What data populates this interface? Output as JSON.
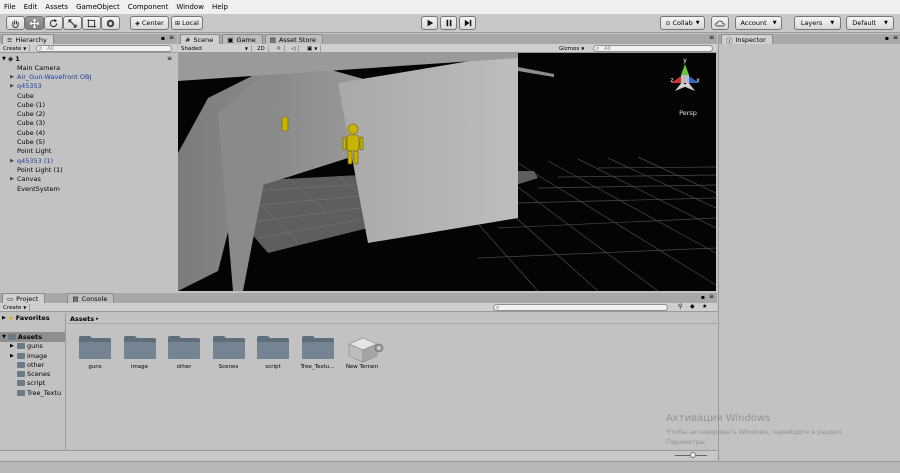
{
  "menu": [
    "File",
    "Edit",
    "Assets",
    "GameObject",
    "Component",
    "Window",
    "Help"
  ],
  "toolbar": {
    "pivot_label": "Center",
    "space_label": "Local",
    "collab_label": "Collab",
    "account_label": "Account",
    "layers_label": "Layers",
    "layout_label": "Default"
  },
  "hierarchy": {
    "tab_label": "Hierarchy",
    "create_label": "Create",
    "search_placeholder": "All",
    "scene_name": "1",
    "items": [
      {
        "label": "Main Camera",
        "arrow": "",
        "color": "black"
      },
      {
        "label": "Air_Gun-Wavefront OBJ",
        "arrow": "▶",
        "color": "blue"
      },
      {
        "label": "q45353",
        "arrow": "▶",
        "color": "blue"
      },
      {
        "label": "Cube",
        "arrow": "",
        "color": "black"
      },
      {
        "label": "Cube (1)",
        "arrow": "",
        "color": "black"
      },
      {
        "label": "Cube (2)",
        "arrow": "",
        "color": "black"
      },
      {
        "label": "Cube (3)",
        "arrow": "",
        "color": "black"
      },
      {
        "label": "Cube (4)",
        "arrow": "",
        "color": "black"
      },
      {
        "label": "Cube (5)",
        "arrow": "",
        "color": "black"
      },
      {
        "label": "Point Light",
        "arrow": "",
        "color": "black"
      },
      {
        "label": "q45353 (1)",
        "arrow": "▶",
        "color": "blue"
      },
      {
        "label": "Point Light (1)",
        "arrow": "",
        "color": "black"
      },
      {
        "label": "Canvas",
        "arrow": "▶",
        "color": "black"
      },
      {
        "label": "EventSystem",
        "arrow": "",
        "color": "black"
      }
    ]
  },
  "scene_view": {
    "tabs": [
      "Scene",
      "Game",
      "Asset Store"
    ],
    "shading_label": "Shaded",
    "mode_2d_label": "2D",
    "gizmos_label": "Gizmos",
    "search_placeholder": "All",
    "projection_label": "Persp",
    "axis_labels": {
      "x": "x",
      "y": "y",
      "z": "z"
    }
  },
  "project": {
    "tabs": [
      "Project",
      "Console"
    ],
    "create_label": "Create",
    "favorites_label": "Favorites",
    "assets_label": "Assets",
    "breadcrumb": "Assets",
    "tree": [
      "guns",
      "image",
      "other",
      "Scenes",
      "script",
      "Tree_Textu"
    ],
    "tree_arrows": [
      "▶",
      "▶",
      "",
      "",
      "",
      ""
    ],
    "assets": [
      "guns",
      "image",
      "other",
      "Scenes",
      "script",
      "Tree_Textu...",
      "New Terrain"
    ]
  },
  "inspector": {
    "tab_label": "Inspector"
  },
  "watermark": {
    "title": "Активация Windows",
    "line1": "Чтобы активировать Windows, перейдите в раздел",
    "line2": "Параметры"
  },
  "colors": {
    "scene_bg": "#040404",
    "figure_yellow": "#c8b400",
    "link_blue": "#1f3fa0",
    "folder": "#6d7a86"
  }
}
